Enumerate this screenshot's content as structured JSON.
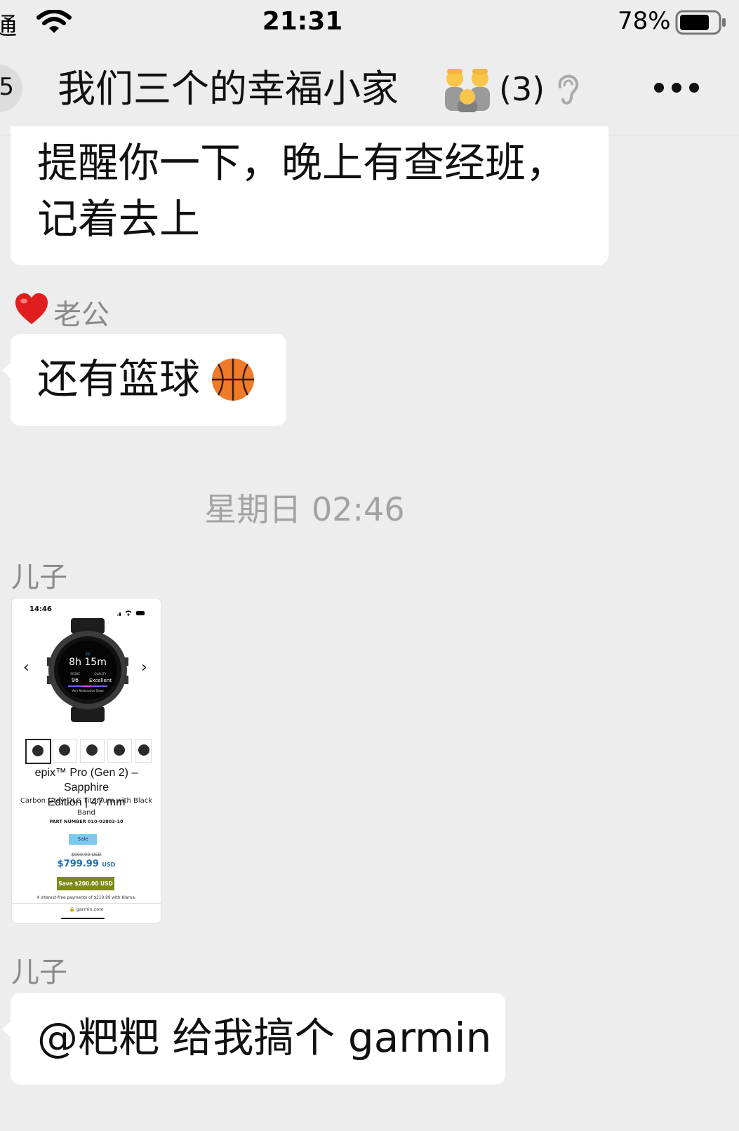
{
  "status_bar": {
    "carrier": "通",
    "time": "21:31",
    "battery_percent": "78%",
    "battery_level": 0.78
  },
  "nav": {
    "back_badge": "5",
    "title": "我们三个的幸福小家",
    "member_count": "(3)",
    "title_icon": "family-emoji-icon",
    "mode_icon": "ear-icon",
    "more_icon": "more-dots-icon"
  },
  "messages": [
    {
      "type": "text",
      "lines": [
        "提醒你一下，晚上有查经班，",
        "记着去上"
      ]
    },
    {
      "type": "text",
      "sender_icon": "heart-icon",
      "sender": "老公",
      "text": "还有篮球",
      "emoji": "basketball-icon"
    },
    {
      "type": "timestamp",
      "text": "星期日 02:46"
    },
    {
      "type": "image",
      "sender": "儿子",
      "image": {
        "time": "14:46",
        "product_title_line1": "epix™ Pro (Gen 2) – Sapphire",
        "product_title_line2": "Edition | 47 mm",
        "subtitle_line1": "Carbon Gray DLC Titanium with Black",
        "subtitle_line2": "Band",
        "part_number": "PART NUMBER 010-02803-10",
        "sale_badge": "Sale",
        "old_price": "$999.99 USD",
        "price": "$799.99",
        "price_currency": "USD",
        "save_text": "Save $200.00 USD",
        "klarna_text": "4 interest-free payments of $219.99 with Klarna.",
        "url": "garmin.com",
        "watch_face": {
          "sleep_time": "8h 15m",
          "score_label": "SCORE",
          "score": "96",
          "quality_label": "QUALITY",
          "quality": "Excellent",
          "caption": "Very Restorative Sleep"
        }
      }
    },
    {
      "type": "text",
      "sender": "儿子",
      "text": "@粑粑 给我搞个 garmin"
    }
  ],
  "colors": {
    "background": "#ededed",
    "bubble": "#ffffff",
    "meta_text": "#8a8a8a",
    "price_blue": "#1f6fb5",
    "save_green": "#7c8a18"
  }
}
